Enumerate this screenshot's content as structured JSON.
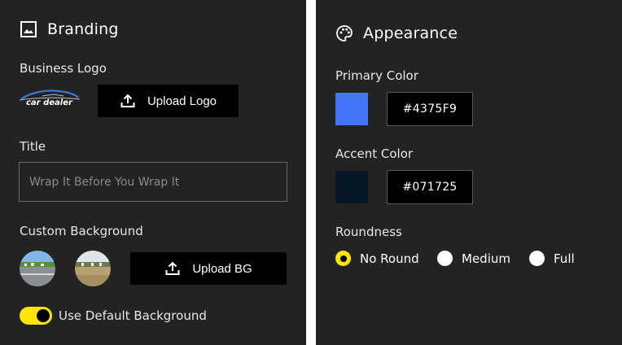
{
  "branding": {
    "title": "Branding",
    "header_icon": "image-icon",
    "logo_label": "Business Logo",
    "logo_text": "car dealer",
    "upload_logo_label": "Upload Logo",
    "upload_icon": "upload-icon",
    "title_label": "Title",
    "title_placeholder": "Wrap It Before You Wrap It",
    "background_label": "Custom Background",
    "upload_bg_label": "Upload BG",
    "default_bg_label": "Use Default Background",
    "default_bg_enabled": true,
    "toggle_color": "#FFE600"
  },
  "appearance": {
    "title": "Appearance",
    "header_icon": "palette-icon",
    "primary_label": "Primary Color",
    "primary_color": "#4375F9",
    "primary_hex": "#4375F9",
    "accent_label": "Accent Color",
    "accent_color": "#071725",
    "accent_hex": "#071725",
    "roundness_label": "Roundness",
    "roundness_options": [
      "No Round",
      "Medium",
      "Full"
    ],
    "roundness_selected": "No Round"
  }
}
